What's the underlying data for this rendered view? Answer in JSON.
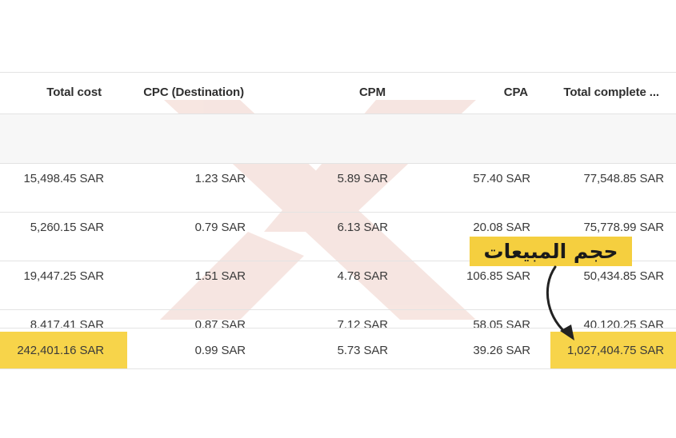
{
  "table": {
    "columns": [
      "Total cost",
      "CPC (Destination)",
      "CPM",
      "CPA",
      "Total complete ..."
    ],
    "rows": [
      [
        "15,498.45 SAR",
        "1.23 SAR",
        "5.89 SAR",
        "57.40 SAR",
        "77,548.85 SAR"
      ],
      [
        "5,260.15 SAR",
        "0.79 SAR",
        "6.13 SAR",
        "20.08 SAR",
        "75,778.99 SAR"
      ],
      [
        "19,447.25 SAR",
        "1.51 SAR",
        "4.78 SAR",
        "106.85 SAR",
        "50,434.85 SAR"
      ],
      [
        "8,417.41 SAR",
        "0.87 SAR",
        "7.12 SAR",
        "58.05 SAR",
        "40,120.25 SAR"
      ]
    ],
    "totals": [
      "242,401.16 SAR",
      "0.99 SAR",
      "5.73 SAR",
      "39.26 SAR",
      "1,027,404.75 SAR"
    ]
  },
  "annotation": {
    "label": "حجم المبيعات"
  },
  "colors": {
    "highlight": "#f7d44a",
    "label_bg": "#f5cf3f",
    "watermark": "#f3ddd8"
  }
}
